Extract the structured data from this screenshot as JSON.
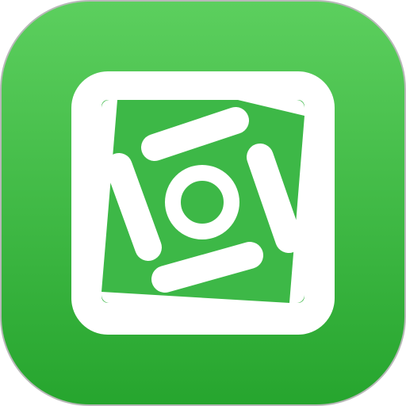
{
  "app_icon": {
    "icon": "pinwheel-camera-icon",
    "colors": {
      "background_top": "#5ccf5e",
      "background_bottom": "#26a52e",
      "inner_field": "#3db847",
      "glyph": "#ffffff",
      "outer_border": "#b8b8b8"
    }
  }
}
